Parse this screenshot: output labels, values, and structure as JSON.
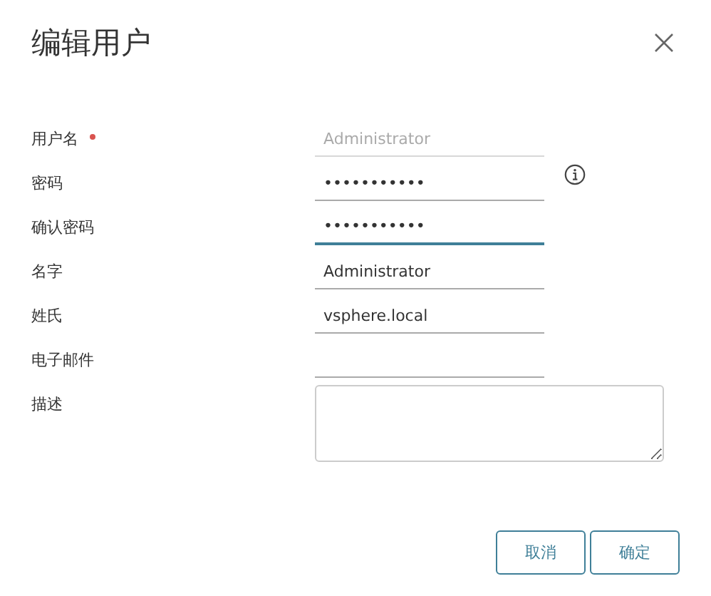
{
  "dialog": {
    "title": "编辑用户"
  },
  "fields": [
    {
      "kind": "input",
      "label": "用户名",
      "required": true,
      "value": "Administrator",
      "disabled": true,
      "focused": false,
      "info": false
    },
    {
      "kind": "input",
      "label": "密码",
      "required": false,
      "value": "•••••••••••",
      "disabled": false,
      "focused": false,
      "info": true
    },
    {
      "kind": "input",
      "label": "确认密码",
      "required": false,
      "value": "•••••••••••",
      "disabled": false,
      "focused": true,
      "info": false
    },
    {
      "kind": "input",
      "label": "名字",
      "required": false,
      "value": "Administrator",
      "disabled": false,
      "focused": false,
      "info": false
    },
    {
      "kind": "input",
      "label": "姓氏",
      "required": false,
      "value": "vsphere.local",
      "disabled": false,
      "focused": false,
      "info": false
    },
    {
      "kind": "input",
      "label": "电子邮件",
      "required": false,
      "disabled": false,
      "focused": false,
      "info": false
    },
    {
      "kind": "textarea",
      "label": "描述",
      "required": false,
      "disabled": false,
      "focused": false,
      "info": false
    }
  ],
  "buttons": [
    "取消",
    "确定"
  ]
}
